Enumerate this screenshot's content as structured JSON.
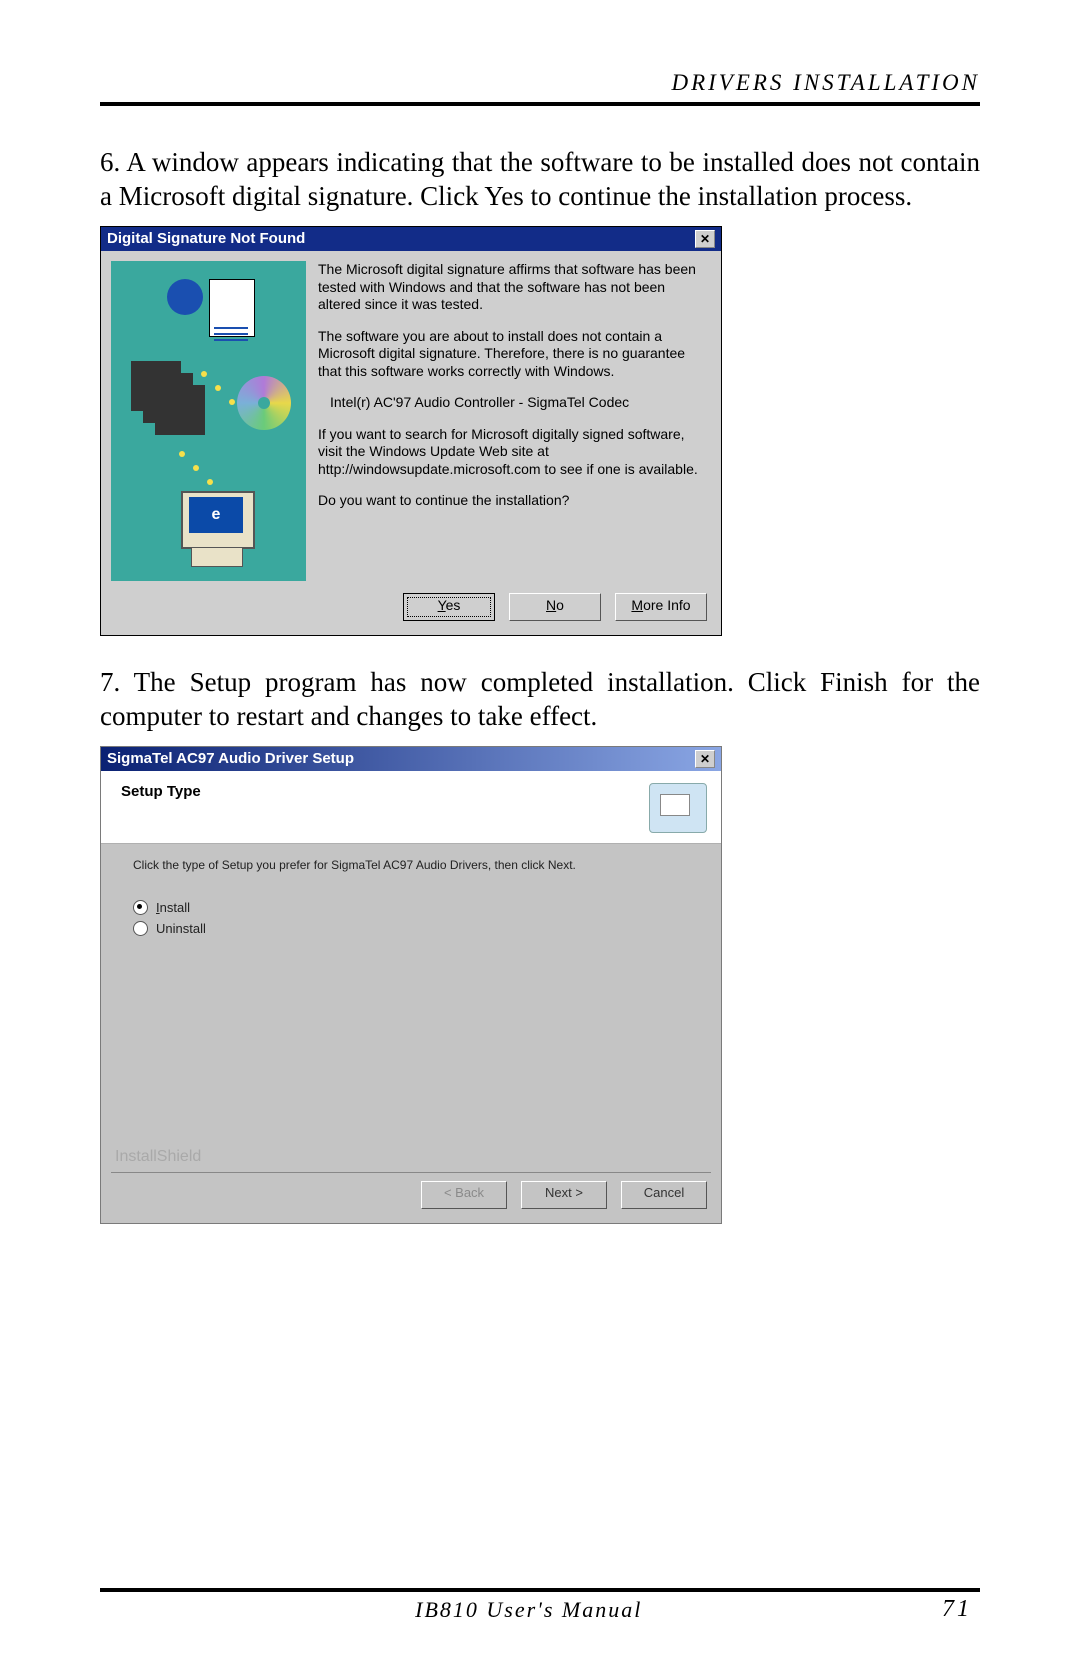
{
  "header": {
    "section_title": "DRIVERS INSTALLATION"
  },
  "step6_text": "6. A window appears indicating that the software to be installed does not contain a Microsoft digital signature. Click Yes to continue the installation process.",
  "dialog1": {
    "title": "Digital Signature Not Found",
    "close_glyph": "✕",
    "p1": "The Microsoft digital signature affirms that software has been tested with Windows and that the software has not been altered since it was tested.",
    "p2": "The software you are about to install does not contain a Microsoft digital signature. Therefore,  there is no guarantee that this software works correctly with Windows.",
    "device": "Intel(r) AC'97 Audio Controller - SigmaTel Codec",
    "p3": "If you want to search for Microsoft digitally signed software, visit the Windows Update Web site at http://windowsupdate.microsoft.com to see if one is available.",
    "p4": "Do you want to continue the installation?",
    "screen_text": "e",
    "buttons": {
      "yes_u": "Y",
      "yes_rest": "es",
      "no_u": "N",
      "no_rest": "o",
      "more_u": "M",
      "more_rest": "ore Info"
    }
  },
  "step7_text": "7. The Setup program has now completed installation.  Click Finish for the computer to restart and changes to take effect.",
  "dialog2": {
    "title": "SigmaTel AC97 Audio Driver Setup",
    "close_glyph": "✕",
    "heading": "Setup Type",
    "instruction": "Click the type of Setup you prefer for SigmaTel AC97 Audio Drivers, then click Next.",
    "option_install_u": "I",
    "option_install_rest": "nstall",
    "option_uninstall": "Uninstall",
    "brand": "InstallShield",
    "buttons": {
      "back_pre": "< ",
      "back_u": "B",
      "back_rest": "ack",
      "next_u": "N",
      "next_rest": "ext >",
      "cancel": "Cancel"
    }
  },
  "footer": {
    "manual": "IB810 User's Manual",
    "page": "71"
  }
}
